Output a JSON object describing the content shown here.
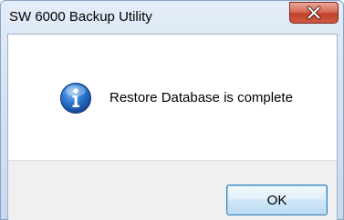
{
  "window": {
    "title": "SW 6000 Backup Utility",
    "close_label": "X"
  },
  "dialog": {
    "icon": "info-icon",
    "message": "Restore Database is complete",
    "ok_label": "OK"
  },
  "colors": {
    "close_button": "#c2412b",
    "info_icon": "#1f5fb5",
    "ok_border": "#3c7fb1"
  }
}
